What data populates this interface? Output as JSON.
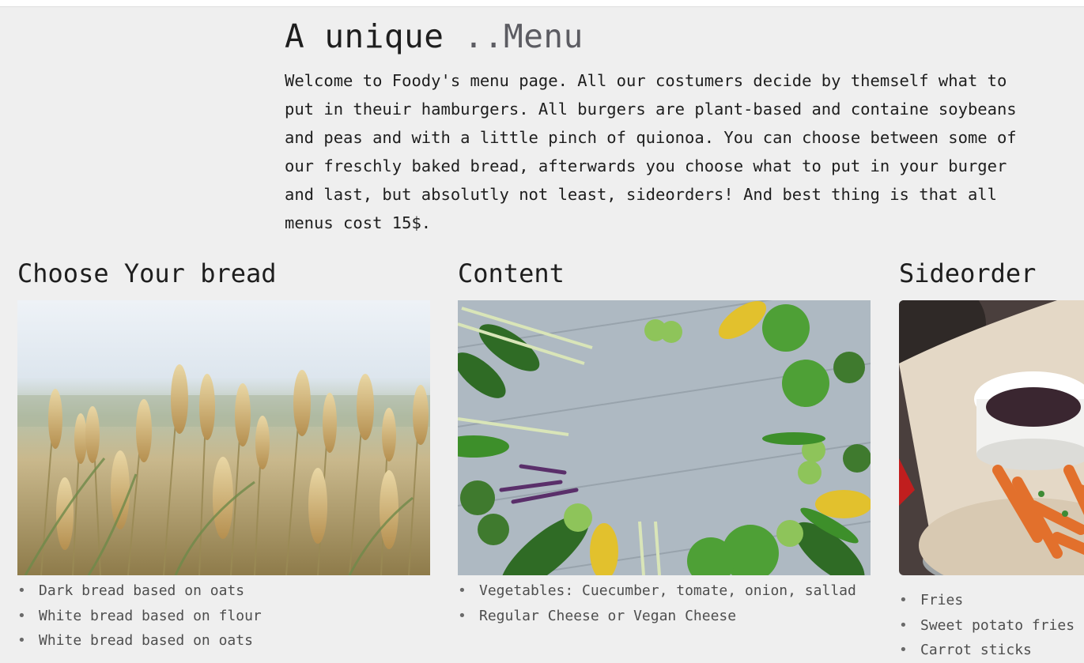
{
  "header": {
    "title_main": "A unique ",
    "title_accent": "..Menu",
    "intro": "Welcome to Foody's menu page. All our costumers decide by themself what to put in theuir hamburgers. All burgers are plant-based and containe soybeans and peas and with a little pinch of quionoa. You can choose between some of our freschly baked bread, afterwards you choose what to put in your burger and last, but absolutly not least, sideorders! And best thing is that all menus cost 15$."
  },
  "sections": {
    "bread": {
      "title": "Choose Your bread",
      "image": "wheat-field-photo",
      "items": [
        "Dark bread based on oats",
        "White bread based on flour",
        "White bread based on oats"
      ]
    },
    "content": {
      "title": "Content",
      "image": "vegetables-on-wood-photo",
      "items": [
        "Vegetables: Cuecumber, tomate, onion, sallad",
        "Regular Cheese or Vegan Cheese"
      ]
    },
    "side": {
      "title": "Sideorder",
      "image": "fries-and-dip-photo",
      "items": [
        "Fries",
        "Sweet potato fries",
        "Carrot sticks"
      ]
    }
  },
  "bullet": "•",
  "colors": {
    "background": "#efefef",
    "text": "#1e1e1e",
    "accent": "#5c5c62",
    "list_text": "#4e4e4e"
  }
}
